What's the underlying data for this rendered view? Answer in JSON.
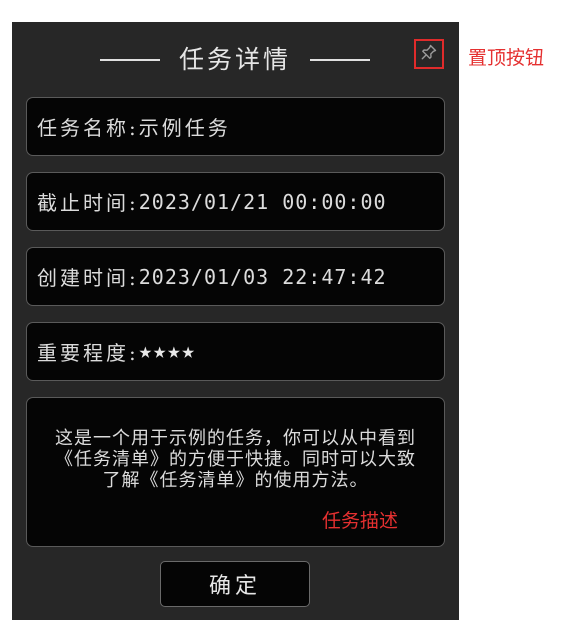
{
  "window": {
    "title": "任务详情"
  },
  "fields": {
    "name": {
      "label": "任务名称:",
      "value": "示例任务"
    },
    "deadline": {
      "label": "截止时间:",
      "value": "2023/01/21 00:00:00"
    },
    "created": {
      "label": "创建时间:",
      "value": "2023/01/03 22:47:42"
    },
    "importance": {
      "label": "重要程度:",
      "stars": "★★★★",
      "rating": 4
    }
  },
  "description": "这是一个用于示例的任务，你可以从中看到《任务清单》的方便于快捷。同时可以大致了解《任务清单》的使用方法。",
  "buttons": {
    "confirm": "确定"
  },
  "annotations": {
    "pin": "置顶按钮",
    "description": "任务描述"
  },
  "icons": {
    "pin": "pin-icon"
  },
  "colors": {
    "window_bg": "#272727",
    "field_bg": "#050505",
    "annotation": "#e53030"
  }
}
